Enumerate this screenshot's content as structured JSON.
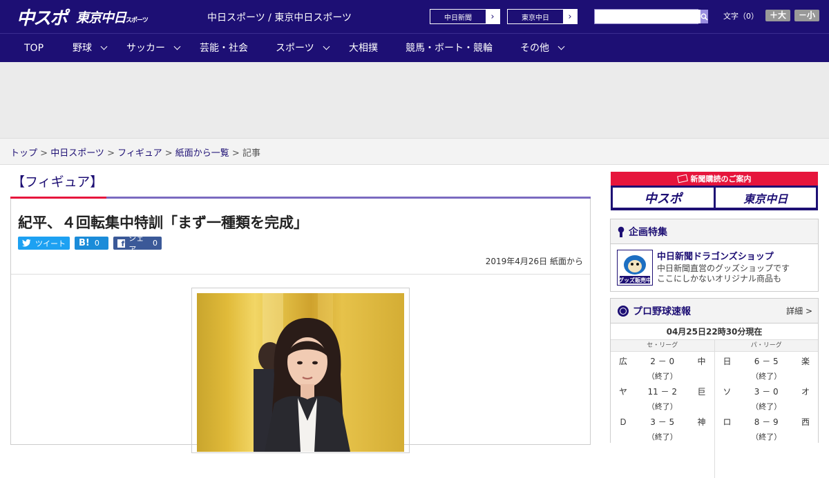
{
  "header": {
    "logo_main": "中スポ",
    "logo_sub": "東京中日",
    "logo_sub_small": "スポーツ",
    "site_title": "中日スポーツ / 東京中日スポーツ",
    "ext_links": [
      "中日新聞",
      "東京中日"
    ],
    "font_size_label": "文字（0）",
    "font_bigger": "＋大",
    "font_smaller": "－小",
    "search_placeholder": ""
  },
  "nav": [
    {
      "label": "TOP",
      "dropdown": false
    },
    {
      "label": "野球",
      "dropdown": true
    },
    {
      "label": "サッカー",
      "dropdown": true
    },
    {
      "label": "芸能・社会",
      "dropdown": false
    },
    {
      "label": "スポーツ",
      "dropdown": true
    },
    {
      "label": "大相撲",
      "dropdown": false
    },
    {
      "label": "競馬・ボート・競輪",
      "dropdown": false
    },
    {
      "label": "その他",
      "dropdown": true
    }
  ],
  "breadcrumb": [
    "トップ",
    "中日スポーツ",
    "フィギュア",
    "紙面から一覧",
    "記事"
  ],
  "article": {
    "category": "【フィギュア】",
    "headline": "紀平、４回転集中特訓「まず一種類を完成」",
    "tweet_label": "ツイート",
    "hatena_count": "0",
    "share_label": "シェア",
    "share_count": "0",
    "date": "2019年4月26日 紙面から"
  },
  "sidebar": {
    "subscribe_title": "新聞購読のご案内",
    "subscribe_logos": [
      "中スポ",
      "東京中日"
    ],
    "feature_title": "企画特集",
    "feature_item_title": "中日新聞ドラゴンズショップ",
    "feature_item_desc1": "中日新聞直営のグッズショップです",
    "feature_item_desc2": "ここにしかないオリジナル商品も",
    "feature_thumb_label": "グッズ販売中",
    "baseball_title": "プロ野球速報",
    "baseball_more": "詳細 >",
    "baseball_time": "04月25日22時30分現在",
    "central_label": "セ・リーグ",
    "pacific_label": "パ・リーグ",
    "central_games": [
      {
        "home": "広",
        "score": "2 － 0",
        "away": "中",
        "status": "（終了）"
      },
      {
        "home": "ヤ",
        "score": "11 － 2",
        "away": "巨",
        "status": "（終了）"
      },
      {
        "home": "Ｄ",
        "score": "3 － 5",
        "away": "神",
        "status": "（終了）"
      }
    ],
    "pacific_games": [
      {
        "home": "日",
        "score": "6 － 5",
        "away": "楽",
        "status": "（終了）"
      },
      {
        "home": "ソ",
        "score": "3 － 0",
        "away": "オ",
        "status": "（終了）"
      },
      {
        "home": "ロ",
        "score": "8 － 9",
        "away": "西",
        "status": "（終了）"
      }
    ]
  },
  "colors": {
    "navy": "#1d0f74",
    "accent_red": "#e6153c",
    "twitter": "#1da1f2",
    "facebook": "#3b5998"
  }
}
